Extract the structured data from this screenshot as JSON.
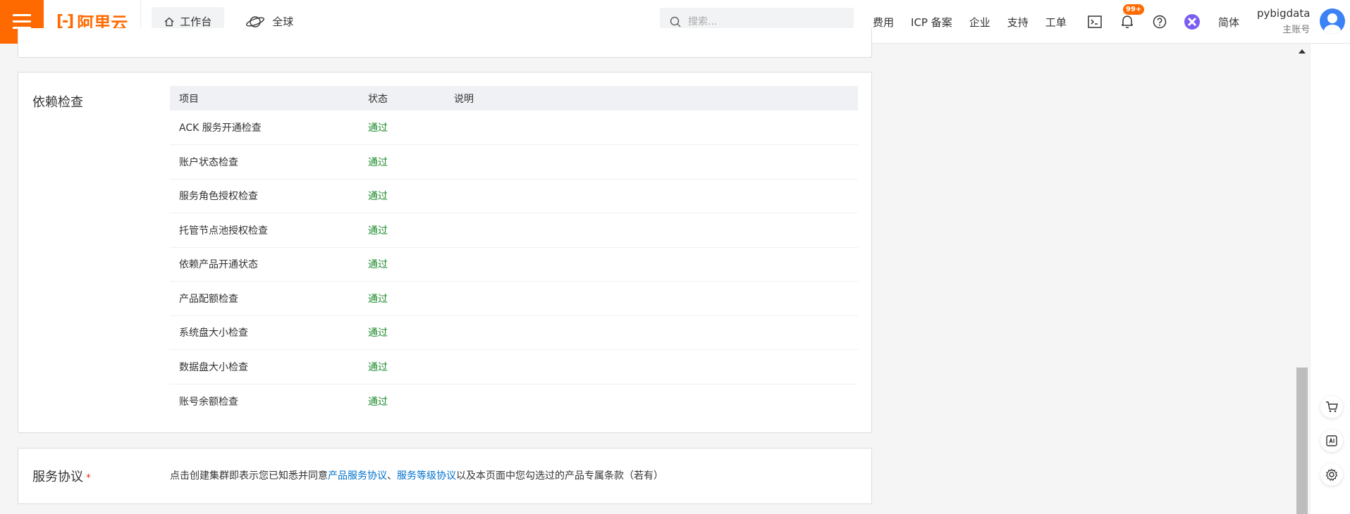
{
  "header": {
    "logo_text": "阿里云",
    "workbench_label": "工作台",
    "global_label": "全球",
    "search_placeholder": "搜索...",
    "nav": [
      "费用",
      "ICP 备案",
      "企业",
      "支持",
      "工单"
    ],
    "notification_badge": "99+",
    "language": "简体",
    "account_name": "pybigdata",
    "account_type": "主账号"
  },
  "dependency_check": {
    "title": "依赖检查",
    "columns": [
      "项目",
      "状态",
      "说明"
    ],
    "rows": [
      {
        "item": "ACK 服务开通检查",
        "status": "通过",
        "note": ""
      },
      {
        "item": "账户状态检查",
        "status": "通过",
        "note": ""
      },
      {
        "item": "服务角色授权检查",
        "status": "通过",
        "note": ""
      },
      {
        "item": "托管节点池授权检查",
        "status": "通过",
        "note": ""
      },
      {
        "item": "依赖产品开通状态",
        "status": "通过",
        "note": ""
      },
      {
        "item": "产品配额检查",
        "status": "通过",
        "note": ""
      },
      {
        "item": "系统盘大小检查",
        "status": "通过",
        "note": ""
      },
      {
        "item": "数据盘大小检查",
        "status": "通过",
        "note": ""
      },
      {
        "item": "账号余额检查",
        "status": "通过",
        "note": ""
      }
    ]
  },
  "service_agreement": {
    "title": "服务协议",
    "required_mark": "*",
    "text_before": "点击创建集群即表示您已知悉并同意",
    "link1": "产品服务协议",
    "separator": "、",
    "link2": "服务等级协议",
    "text_after": "以及本页面中您勾选过的产品专属条款（若有）"
  },
  "colors": {
    "brand": "#ff6a00",
    "pass": "#1a8a2a",
    "link": "#0070cc"
  }
}
